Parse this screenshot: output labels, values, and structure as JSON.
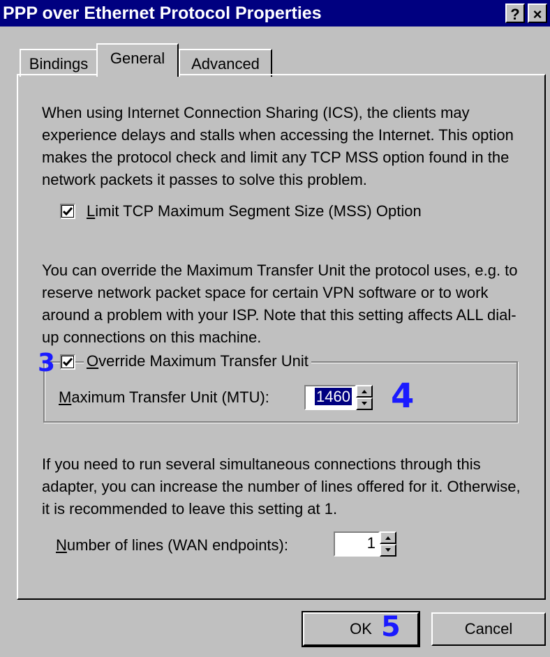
{
  "window": {
    "title": "PPP over Ethernet Protocol Properties",
    "help_label": "?",
    "close_label": "×"
  },
  "tabs": [
    {
      "label": "Bindings"
    },
    {
      "label": "General",
      "active": true
    },
    {
      "label": "Advanced"
    }
  ],
  "general": {
    "mss_description": "When using Internet Connection Sharing (ICS), the clients may experience delays and stalls when accessing the Internet. This option makes the protocol check and limit any TCP MSS option found in the network packets it passes to solve this problem.",
    "mss_checkbox": {
      "label_access": "L",
      "label_rest": "imit TCP Maximum Segment Size (MSS) Option",
      "checked": true
    },
    "mtu_description": "You can override the Maximum Transfer Unit the protocol uses, e.g. to reserve network packet space for certain VPN software or to work around a problem with your ISP. Note that this setting affects ALL dial-up connections on this machine.",
    "mtu_checkbox": {
      "label_access": "O",
      "label_rest": "verride Maximum Transfer Unit",
      "checked": true
    },
    "mtu_field": {
      "label_access": "M",
      "label_rest": "aximum Transfer Unit (MTU):",
      "value": "1460"
    },
    "lines_description": "If you need to run several simultaneous connections through this adapter, you can increase the number of lines offered for it. Otherwise, it is recommended to leave this setting at 1.",
    "lines_field": {
      "label_access": "N",
      "label_rest": "umber of lines (WAN endpoints):",
      "value": "1"
    }
  },
  "buttons": {
    "ok_label": "OK",
    "cancel_label": "Cancel"
  },
  "annotations": {
    "step3": "3",
    "step4": "4",
    "step5": "5",
    "color": "#1a1aff"
  }
}
